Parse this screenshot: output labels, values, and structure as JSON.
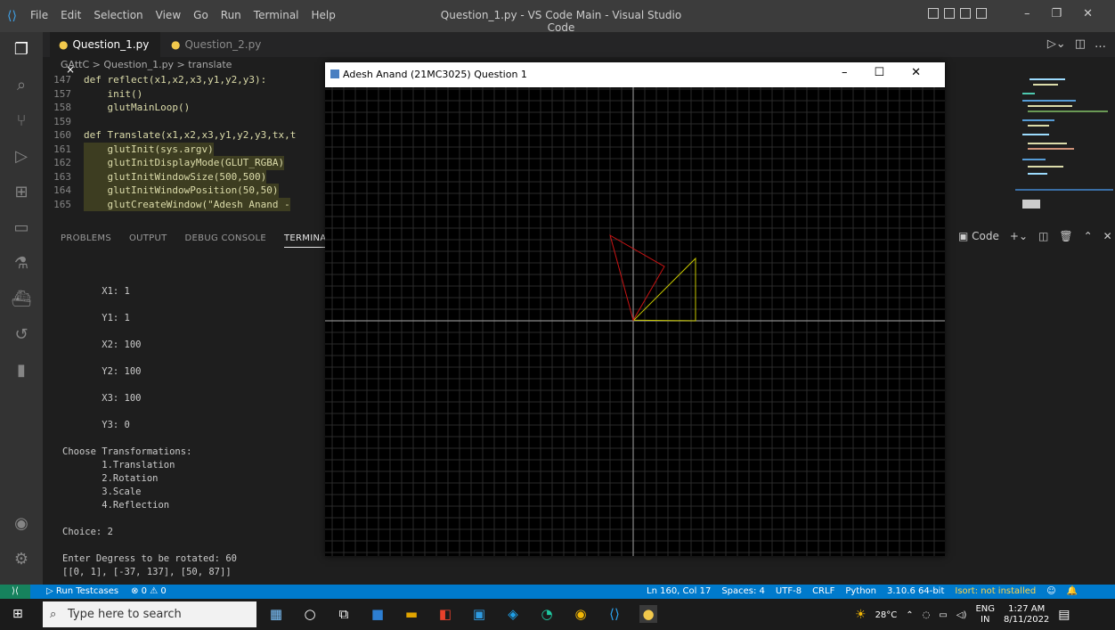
{
  "titlebar": {
    "menu": [
      "File",
      "Edit",
      "Selection",
      "View",
      "Go",
      "Run",
      "Terminal",
      "Help"
    ],
    "window_title": "Question_1.py - VS Code Main - Visual Studio Code"
  },
  "tabs": [
    {
      "label": "Question_1.py",
      "close": "×"
    },
    {
      "label": "Question_2.py"
    }
  ],
  "breadcrumb": "GAttC > Question_1.py > translate",
  "code": [
    {
      "num": "147",
      "text": "def reflect(x1,x2,x3,y1,y2,y3):"
    },
    {
      "num": "157",
      "text": "    init()"
    },
    {
      "num": "158",
      "text": "    glutMainLoop()"
    },
    {
      "num": "159",
      "text": ""
    },
    {
      "num": "160",
      "text": "def Translate(x1,x2,x3,y1,y2,y3,tx,t"
    },
    {
      "num": "161",
      "text": "    glutInit(sys.argv)"
    },
    {
      "num": "162",
      "text": "    glutInitDisplayMode(GLUT_RGBA)"
    },
    {
      "num": "163",
      "text": "    glutInitWindowSize(500,500)"
    },
    {
      "num": "164",
      "text": "    glutInitWindowPosition(50,50)"
    },
    {
      "num": "165",
      "text": "    glutCreateWindow(\"Adesh Anand -"
    }
  ],
  "panel": {
    "tabs": [
      "PROBLEMS",
      "OUTPUT",
      "DEBUG CONSOLE",
      "TERMINAL"
    ],
    "shell": "Code"
  },
  "terminal": [
    "",
    "       X1: 1",
    "",
    "       Y1: 1",
    "",
    "       X2: 100",
    "",
    "       Y2: 100",
    "",
    "       X3: 100",
    "",
    "       Y3: 0",
    "",
    "Choose Transformations:",
    "       1.Translation",
    "       2.Rotation",
    "       3.Scale",
    "       4.Reflection",
    "",
    "Choice: 2",
    "",
    "Enter Degress to be rotated: 60",
    "[[0, 1], [-37, 137], [50, 87]]"
  ],
  "status": {
    "left": [
      "Run Testcases",
      "⊗ 0 ⚠ 0"
    ],
    "right": [
      "Ln 160, Col 17",
      "Spaces: 4",
      "UTF-8",
      "CRLF",
      "Python",
      "3.10.6 64-bit",
      "Isort: not installed"
    ]
  },
  "glwindow": {
    "title": "Adesh Anand (21MC3025) Question 1",
    "grid_color": "#2a2a2a",
    "axis_color": "#8a8a8a",
    "original_color": "#c8c800",
    "rotated_color": "#c81414"
  },
  "taskbar": {
    "search_placeholder": "Type here to search",
    "weather": "28°C",
    "lang": "ENG",
    "region": "IN",
    "time": "1:27 AM",
    "date": "8/11/2022"
  },
  "colors": {
    "accent": "#007acc",
    "remote": "#16825d"
  }
}
